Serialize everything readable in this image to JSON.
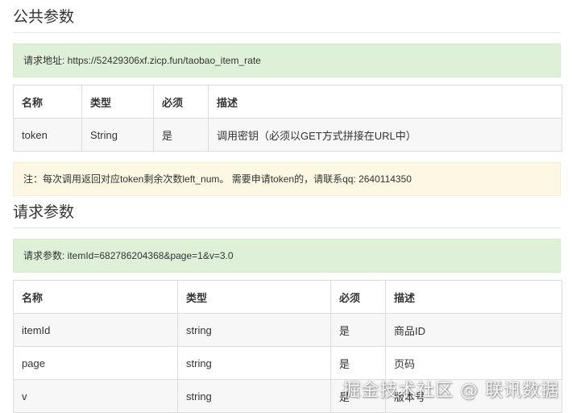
{
  "public_params": {
    "title": "公共参数",
    "request_url": "请求地址: https://52429306xf.zicp.fun/taobao_item_rate",
    "columns": [
      "名称",
      "类型",
      "必须",
      "描述"
    ],
    "rows": [
      [
        "token",
        "String",
        "是",
        "调用密钥（必须以GET方式拼接在URL中）"
      ]
    ],
    "note": "注：每次调用返回对应token剩余次数left_num。 需要申请token的，请联系qq: 2640114350"
  },
  "request_params": {
    "title": "请求参数",
    "request_example": "请求参数: itemId=682786204368&page=1&v=3.0",
    "columns": [
      "名称",
      "类型",
      "必须",
      "描述"
    ],
    "rows": [
      [
        "itemId",
        "string",
        "是",
        "商品ID"
      ],
      [
        "page",
        "string",
        "是",
        "页码"
      ],
      [
        "v",
        "string",
        "是",
        "版本号"
      ]
    ]
  },
  "watermark": "掘金技术社区 @ 联讯数据"
}
